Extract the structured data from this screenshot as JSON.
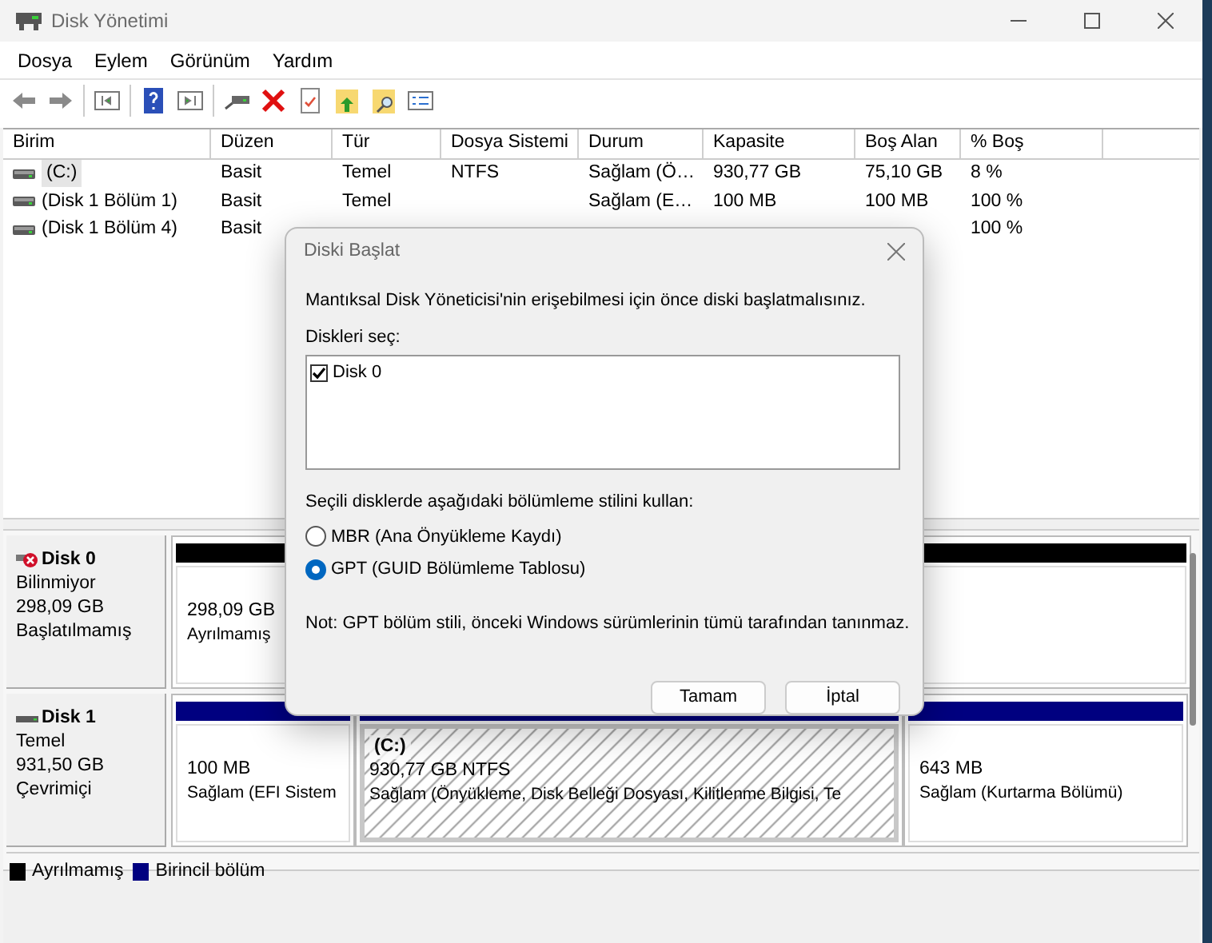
{
  "window": {
    "title": "Disk Yönetimi"
  },
  "menu": [
    "Dosya",
    "Eylem",
    "Görünüm",
    "Yardım"
  ],
  "table": {
    "columns": [
      "Birim",
      "Düzen",
      "Tür",
      "Dosya Sistemi",
      "Durum",
      "Kapasite",
      "Boş Alan",
      "% Boş"
    ],
    "rows": [
      {
        "selected": true,
        "cells": [
          "(C:)",
          "Basit",
          "Temel",
          "NTFS",
          "Sağlam (Ö…",
          "930,77 GB",
          "75,10 GB",
          "8 %"
        ]
      },
      {
        "selected": false,
        "cells": [
          "(Disk 1 Bölüm 1)",
          "Basit",
          "Temel",
          null,
          "Sağlam (E…",
          "100 MB",
          "100 MB",
          "100 %"
        ]
      },
      {
        "selected": false,
        "cells": [
          "(Disk 1 Bölüm 4)",
          "Basit",
          null,
          null,
          null,
          null,
          null,
          "100 %"
        ]
      }
    ]
  },
  "disks": [
    {
      "name": "Disk 0",
      "kind": "uninitialized",
      "type": "Bilinmiyor",
      "size": "298,09 GB",
      "status": "Başlatılmamış",
      "partitions": [
        {
          "kind": "unallocated",
          "selected": false,
          "size": "298,09 GB",
          "status": "Ayrılmamış"
        }
      ]
    },
    {
      "name": "Disk 1",
      "kind": "basic",
      "type": "Temel",
      "size": "931,50 GB",
      "status": "Çevrimiçi",
      "partitions": [
        {
          "kind": "primary",
          "selected": false,
          "size": "100 MB",
          "status": "Sağlam (EFI Sistem"
        },
        {
          "kind": "primary",
          "selected": true,
          "label": "(C:)",
          "size": "930,77 GB NTFS",
          "status": "Sağlam (Önyükleme, Disk Belleği Dosyası, Kilitlenme Bilgisi, Te"
        },
        {
          "kind": "primary",
          "selected": false,
          "size": "643 MB",
          "status": "Sağlam (Kurtarma Bölümü)"
        }
      ]
    }
  ],
  "legend": [
    {
      "label": "Ayrılmamış",
      "color": "#000000"
    },
    {
      "label": "Birincil bölüm",
      "color": "#000080"
    }
  ],
  "dialog": {
    "title": "Diski Başlat",
    "message": "Mantıksal Disk Yöneticisi'nin erişebilmesi için önce diski başlatmalısınız.",
    "list_label": "Diskleri seç:",
    "disks": [
      {
        "label": "Disk 0",
        "checked": true
      }
    ],
    "style_label": "Seçili disklerde aşağıdaki bölümleme stilini kullan:",
    "options": [
      {
        "label": "MBR (Ana Önyükleme Kaydı)",
        "selected": false
      },
      {
        "label": "GPT (GUID Bölümleme Tablosu)",
        "selected": true
      }
    ],
    "note": "Not: GPT bölüm stili, önceki Windows sürümlerinin tümü tarafından tanınmaz.",
    "buttons": [
      "Tamam",
      "İptal"
    ]
  }
}
